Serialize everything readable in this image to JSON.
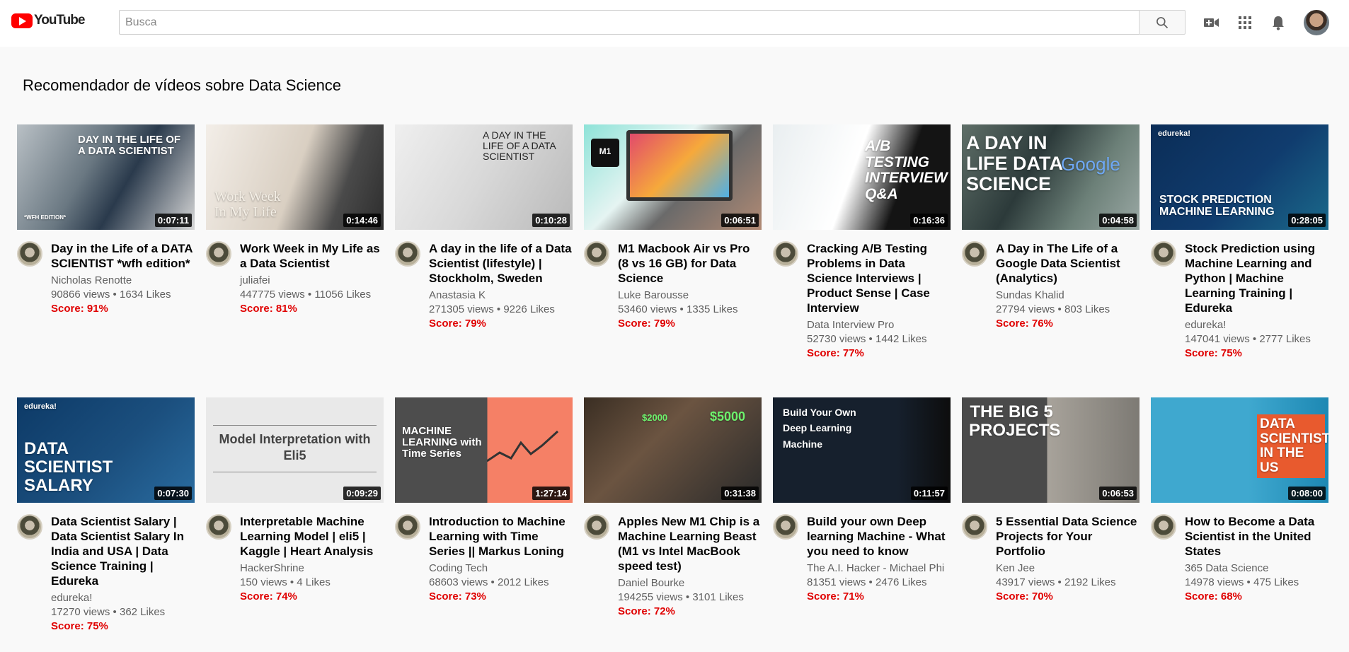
{
  "app": {
    "logo_text": "YouTube"
  },
  "search": {
    "placeholder": "Busca"
  },
  "page": {
    "title": "Recomendador de vídeos sobre Data Science"
  },
  "videos": [
    {
      "title": "Day in the Life of a DATA SCIENTIST *wfh edition*",
      "channel": "Nicholas Renotte",
      "stats": "90866 views • 1634 Likes",
      "score": "Score: 91%",
      "duration": "0:07:11",
      "thumb_text": "DAY IN THE LIFE OF A DATA SCIENTIST",
      "thumb_badge": "*WFH EDITION*"
    },
    {
      "title": "Work Week in My Life as a Data Scientist",
      "channel": "juliafei",
      "stats": "447775 views • 11056 Likes",
      "score": "Score: 81%",
      "duration": "0:14:46",
      "thumb_text": "Work Week In My Life"
    },
    {
      "title": "A day in the life of a Data Scientist (lifestyle) | Stockholm, Sweden",
      "channel": "Anastasia K",
      "stats": "271305 views • 9226 Likes",
      "score": "Score: 79%",
      "duration": "0:10:28",
      "thumb_text": "A DAY IN THE LIFE OF A DATA SCIENTIST"
    },
    {
      "title": "M1 Macbook Air vs Pro (8 vs 16 GB) for Data Science",
      "channel": "Luke Barousse",
      "stats": "53460 views • 1335 Likes",
      "score": "Score: 79%",
      "duration": "0:06:51",
      "thumb_text": "M1"
    },
    {
      "title": "Cracking A/B Testing Problems in Data Science Interviews | Product Sense | Case Interview",
      "channel": "Data Interview Pro",
      "stats": "52730 views • 1442 Likes",
      "score": "Score: 77%",
      "duration": "0:16:36",
      "thumb_text": "A/B TESTING INTERVIEW Q&A"
    },
    {
      "title": "A Day in The Life of a Google Data Scientist (Analytics)",
      "channel": "Sundas Khalid",
      "stats": "27794 views • 803 Likes",
      "score": "Score: 76%",
      "duration": "0:04:58",
      "thumb_text": "A DAY IN LIFE DATA SCIENCE",
      "thumb_badge": "Google"
    },
    {
      "title": "Stock Prediction using Machine Learning and Python | Machine Learning Training | Edureka",
      "channel": "edureka!",
      "stats": "147041 views • 2777 Likes",
      "score": "Score: 75%",
      "duration": "0:28:05",
      "thumb_text": "STOCK PREDICTION MACHINE LEARNING",
      "thumb_badge": "edureka!"
    },
    {
      "title": "Data Scientist Salary | Data Scientist Salary In India and USA | Data Science Training | Edureka",
      "channel": "edureka!",
      "stats": "17270 views • 362 Likes",
      "score": "Score: 75%",
      "duration": "0:07:30",
      "thumb_text": "DATA SCIENTIST SALARY",
      "thumb_badge": "edureka!"
    },
    {
      "title": "Interpretable Machine Learning Model | eli5 | Kaggle | Heart Analysis",
      "channel": "HackerShrine",
      "stats": "150 views • 4 Likes",
      "score": "Score: 74%",
      "duration": "0:09:29",
      "thumb_text": "Model Interpretation with Eli5"
    },
    {
      "title": "Introduction to Machine Learning with Time Series || Markus Loning",
      "channel": "Coding Tech",
      "stats": "68603 views • 2012 Likes",
      "score": "Score: 73%",
      "duration": "1:27:14",
      "thumb_text": "MACHINE LEARNING with Time Series"
    },
    {
      "title": "Apples New M1 Chip is a Machine Learning Beast (M1 vs Intel MacBook speed test)",
      "channel": "Daniel Bourke",
      "stats": "194255 views • 3101 Likes",
      "score": "Score: 72%",
      "duration": "0:31:38",
      "thumb_text": "$5000",
      "thumb_badge": "$2000"
    },
    {
      "title": "Build your own Deep learning Machine - What you need to know",
      "channel": "The A.I. Hacker - Michael Phi",
      "stats": "81351 views • 2476 Likes",
      "score": "Score: 71%",
      "duration": "0:11:57",
      "thumb_text": "Build Your Own Deep Learning Machine"
    },
    {
      "title": "5 Essential Data Science Projects for Your Portfolio",
      "channel": "Ken Jee",
      "stats": "43917 views • 2192 Likes",
      "score": "Score: 70%",
      "duration": "0:06:53",
      "thumb_text": "THE BIG 5 PROJECTS"
    },
    {
      "title": "How to Become a Data Scientist in the United States",
      "channel": "365 Data Science",
      "stats": "14978 views • 475 Likes",
      "score": "Score: 68%",
      "duration": "0:08:00",
      "thumb_text": "DATA SCIENTIST IN THE US"
    }
  ]
}
